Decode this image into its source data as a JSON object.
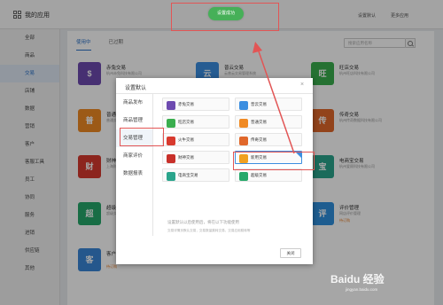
{
  "topbar": {
    "title": "我的应用",
    "links": [
      "设置默认",
      "更多应用"
    ],
    "toast": "设置成功"
  },
  "sidebar": {
    "items": [
      "全部",
      "商品",
      "交易",
      "店铺",
      "数据",
      "营销",
      "客户",
      "客服工具",
      "员工",
      "协同",
      "服务",
      "进销",
      "供应链",
      "其他"
    ],
    "active_index": 2
  },
  "main": {
    "tabs": [
      "使用中",
      "已过期"
    ],
    "active_tab": 0,
    "search_placeholder": "搜索应用名称",
    "cards": [
      {
        "name": "赤兔交易",
        "desc": "杭州赤兔科技有限公司",
        "icon": "$",
        "color": "#6d4ab0"
      },
      {
        "name": "普云交易",
        "desc": "云普云交易管理系统",
        "icon": "云",
        "color": "#3b8ee0"
      },
      {
        "name": "旺店交易",
        "desc": "杭州旺店科技有限公司",
        "icon": "旺",
        "color": "#3aae4e"
      },
      {
        "name": "普通交易",
        "desc": "普通交易管理系统",
        "icon": "普",
        "color": "#f08a24"
      },
      {
        "name": "传奇交易",
        "desc": "杭州传奇数据科技有限公司",
        "icon": "传",
        "color": "#e0672a"
      },
      {
        "name": "财神交易",
        "desc": "上海财神软件",
        "icon": "财",
        "color": "#d83a2e"
      },
      {
        "name": "电商宝交易",
        "desc": "杭州爱顾科技有限公司",
        "icon": "宝",
        "color": "#2aa58c"
      },
      {
        "name": "超级交易",
        "desc": "超级交易管理系统",
        "icon": "超",
        "color": "#26a86a"
      },
      {
        "name": "评价管理",
        "desc": "网店评价管理",
        "icon": "评",
        "color": "#2f8fde",
        "tag": "待订购"
      },
      {
        "name": "客户",
        "desc": "",
        "icon": "客",
        "color": "#3a86d8",
        "tag": "待订购"
      }
    ]
  },
  "dialog": {
    "title": "设置默认",
    "close": "×",
    "nav": [
      "商品发布",
      "商品管理",
      "交易管理",
      "商家评价",
      "数据报表"
    ],
    "active_nav": 2,
    "options": [
      {
        "label": "赤兔交易",
        "color": "#6d4ab0",
        "icon": "$"
      },
      {
        "label": "普云交易",
        "color": "#3b8ee0",
        "icon": "云"
      },
      {
        "label": "旺店交易",
        "color": "#3aae4e",
        "icon": "旺"
      },
      {
        "label": "普通交易",
        "color": "#f08a24",
        "icon": "普"
      },
      {
        "label": "火牛交易",
        "color": "#d83a2e",
        "icon": "火"
      },
      {
        "label": "传奇交易",
        "color": "#e0672a",
        "icon": "传"
      },
      {
        "label": "财神交易",
        "color": "#c8302a",
        "icon": "财"
      },
      {
        "label": "新用交易",
        "color": "#f0a020",
        "icon": "新",
        "selected": true
      },
      {
        "label": "电商宝交易",
        "color": "#2aa58c",
        "icon": "宝"
      },
      {
        "label": "超级交易",
        "color": "#26a86a",
        "icon": "超"
      }
    ],
    "note": "设置默认以后使用后，将在以下功能使用",
    "note2": "交易详情页默认交易，交易数量跳转交易，交易应用跳转等",
    "close_button": "关闭"
  },
  "watermark": {
    "text": "Baidu 经验",
    "sub": "jingyan.baidu.com"
  },
  "colors": {
    "accent": "#2b72c8",
    "success": "#46b058",
    "annotation": "#e25555"
  }
}
